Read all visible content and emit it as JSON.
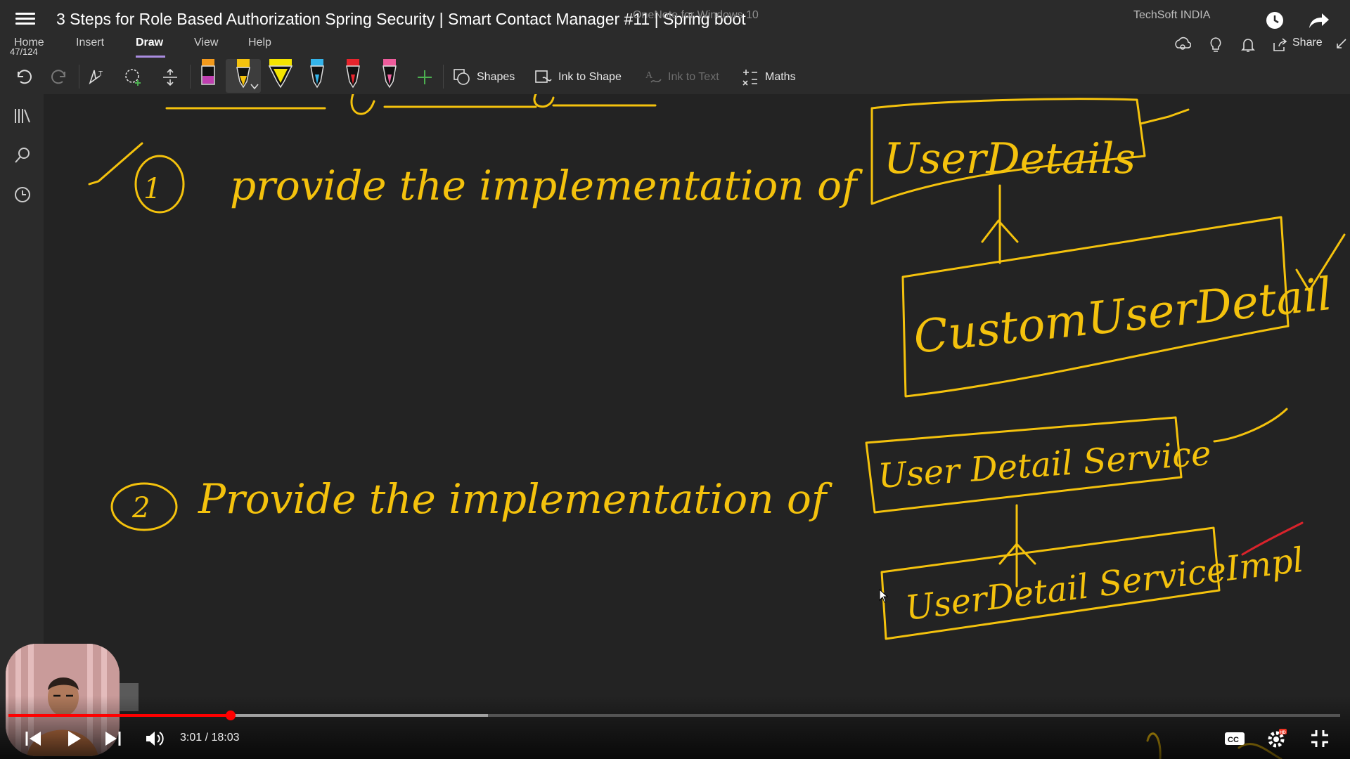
{
  "video": {
    "title": "3 Steps for Role Based Authorization Spring Security | Smart Contact Manager #11 | Spring boot",
    "time_display": "3:01 / 18:03",
    "progress_fraction": 0.167,
    "buffered_fraction": 0.36
  },
  "app": {
    "title": "OneNote for Windows 10",
    "org": "TechSoft INDIA",
    "page_counter": "47/124"
  },
  "tabs": [
    "Home",
    "Insert",
    "Draw",
    "View",
    "Help"
  ],
  "active_tab": "Draw",
  "share_label": "Share",
  "ribbon": {
    "shapes": "Shapes",
    "ink_to_shape": "Ink to Shape",
    "ink_to_text": "Ink to Text",
    "maths": "Maths"
  },
  "ink_text": {
    "step1": "provide the implementation of",
    "step1_num": "1",
    "box_user_details": "UserDetails",
    "box_custom_user_detail": "CustomUserDetail",
    "step2": "Provide the implementation of",
    "step2_num": "2",
    "box_user_detail_service": "User Detail Service",
    "box_user_detail_service_impl": "UserDetail ServiceImpl"
  },
  "colors": {
    "ink": "#f4c20d",
    "red_ink": "#d9232b",
    "progress": "#ff0000",
    "accent_tab": "#a98ce0"
  }
}
